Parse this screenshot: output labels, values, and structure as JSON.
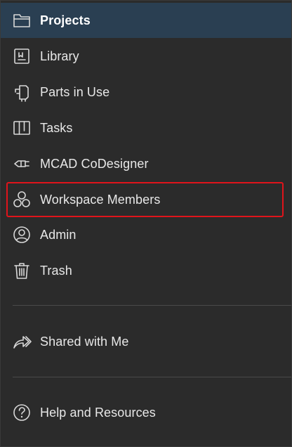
{
  "nav": {
    "items": [
      {
        "label": "Projects",
        "icon": "folder-icon"
      },
      {
        "label": "Library",
        "icon": "library-icon"
      },
      {
        "label": "Parts in Use",
        "icon": "parts-icon"
      },
      {
        "label": "Tasks",
        "icon": "tasks-icon"
      },
      {
        "label": "MCAD CoDesigner",
        "icon": "plug-icon"
      },
      {
        "label": "Workspace Members",
        "icon": "members-icon"
      },
      {
        "label": "Admin",
        "icon": "user-circle-icon"
      },
      {
        "label": "Trash",
        "icon": "trash-icon"
      }
    ],
    "shared": {
      "label": "Shared with Me",
      "icon": "share-icon"
    },
    "help": {
      "label": "Help and Resources",
      "icon": "help-icon"
    }
  },
  "colors": {
    "background": "#2b2b2b",
    "active_background": "#2a3f52",
    "highlight_border": "#e0141b",
    "text": "#e8e8e8"
  }
}
